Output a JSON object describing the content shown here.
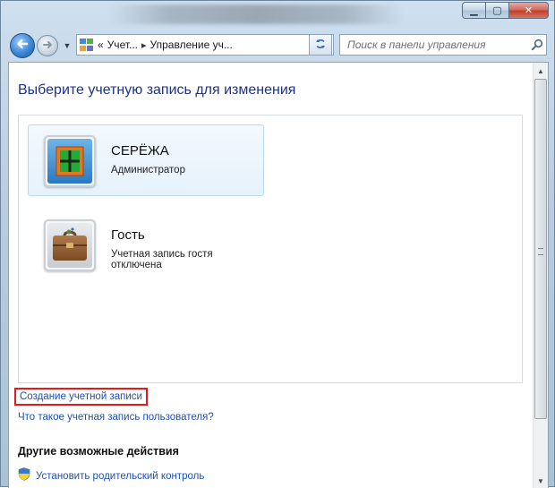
{
  "window": {
    "caption_buttons": {
      "minimize": "▁",
      "maximize": "▢",
      "close": "✕"
    }
  },
  "navigation": {
    "back_icon": "back-arrow-icon",
    "forward_icon": "forward-arrow-icon",
    "address": {
      "prefix": "«",
      "segments": [
        "Учет...",
        "Управление уч..."
      ],
      "separator": "▸"
    },
    "refresh_icon": "refresh-icon",
    "search": {
      "placeholder": "Поиск в панели управления"
    }
  },
  "main": {
    "title": "Выберите учетную запись для изменения",
    "accounts": [
      {
        "name": "СЕРЁЖА",
        "role": "Администратор",
        "picture": "green-window-picture",
        "selected": true
      },
      {
        "name": "Гость",
        "role": "Учетная запись гостя отключена",
        "picture": "briefcase-picture",
        "selected": false
      }
    ],
    "links": {
      "create_account": "Создание учетной записи",
      "what_is_account": "Что такое учетная запись пользователя?"
    },
    "other_actions": {
      "heading": "Другие возможные действия",
      "items": [
        {
          "label": "Установить родительский контроль",
          "icon": "shield-icon"
        }
      ]
    }
  },
  "colors": {
    "title": "#1e3287",
    "link": "#1a51ba",
    "highlight_border": "#e21c1c",
    "selection_bg": "#e6f2fb"
  }
}
